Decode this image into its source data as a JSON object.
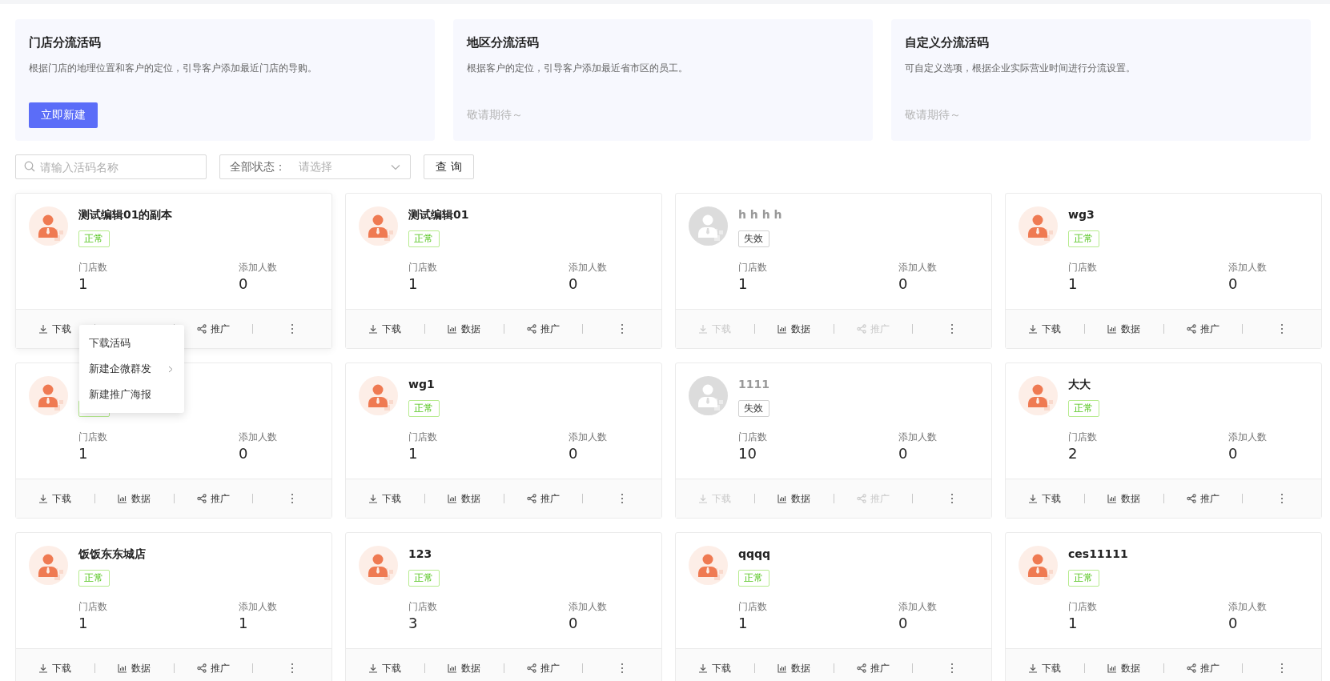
{
  "feature_cards": [
    {
      "title": "门店分流活码",
      "description": "根据门店的地理位置和客户的定位，引导客户添加最近门店的导购。",
      "button": "立即新建"
    },
    {
      "title": "地区分流活码",
      "description": "根据客户的定位，引导客户添加最近省市区的员工。",
      "note": "敬请期待～"
    },
    {
      "title": "自定义分流活码",
      "description": "可自定义选项，根据企业实际营业时间进行分流设置。",
      "note": "敬请期待～"
    }
  ],
  "filters": {
    "search": {
      "placeholder": "请输入活码名称"
    },
    "status_select": {
      "label": "全部状态：",
      "placeholder": "请选择"
    },
    "query_button": "查 询"
  },
  "codes": [
    {
      "name": "测试编辑01的副本",
      "expired": false,
      "status_label": "正常",
      "stats": [
        {
          "label": "门店数",
          "value": "1"
        },
        {
          "label": "添加人数",
          "value": "0"
        }
      ],
      "actions": [
        {
          "kind": "download",
          "label": "下载",
          "disabled": false
        },
        {
          "kind": "data"
        },
        {
          "kind": "promote",
          "label": "推广",
          "disabled": false
        },
        {
          "kind": "more"
        }
      ],
      "menu": [
        {
          "label": "下载活码",
          "submenu": false
        },
        {
          "label": "新建企微群发",
          "submenu": true
        },
        {
          "label": "新建推广海报",
          "submenu": false
        }
      ]
    },
    {
      "name": "测试编辑01",
      "expired": false,
      "status_label": "正常",
      "stats": [
        {
          "label": "门店数",
          "value": "1"
        },
        {
          "label": "添加人数",
          "value": "0"
        }
      ],
      "actions": [
        {
          "kind": "download",
          "label": "下载",
          "disabled": false
        },
        {
          "kind": "data",
          "label": "数据",
          "disabled": false
        },
        {
          "kind": "promote",
          "label": "推广",
          "disabled": false
        },
        {
          "kind": "more"
        }
      ]
    },
    {
      "name": "h h h h",
      "expired": true,
      "status_label": "失效",
      "stats": [
        {
          "label": "门店数",
          "value": "1"
        },
        {
          "label": "添加人数",
          "value": "0"
        }
      ],
      "actions": [
        {
          "kind": "download",
          "label": "下载",
          "disabled": true
        },
        {
          "kind": "data",
          "label": "数据",
          "disabled": false
        },
        {
          "kind": "promote",
          "label": "推广",
          "disabled": true
        },
        {
          "kind": "more"
        }
      ]
    },
    {
      "name": "wg3",
      "expired": false,
      "status_label": "正常",
      "stats": [
        {
          "label": "门店数",
          "value": "1"
        },
        {
          "label": "添加人数",
          "value": "0"
        }
      ],
      "actions": [
        {
          "kind": "download",
          "label": "下载",
          "disabled": false
        },
        {
          "kind": "data",
          "label": "数据",
          "disabled": false
        },
        {
          "kind": "promote",
          "label": "推广",
          "disabled": false
        },
        {
          "kind": "more"
        }
      ]
    },
    {
      "expired": false,
      "stats": [
        {
          "label": "门店数",
          "value": "1"
        },
        {
          "label": "添加人数",
          "value": "0"
        }
      ],
      "actions": [
        {
          "kind": "download",
          "label": "下载",
          "disabled": false
        },
        {
          "kind": "data",
          "label": "数据",
          "disabled": false
        },
        {
          "kind": "promote",
          "label": "推广",
          "disabled": false
        },
        {
          "kind": "more"
        }
      ]
    },
    {
      "name": "wg1",
      "expired": false,
      "status_label": "正常",
      "stats": [
        {
          "label": "门店数",
          "value": "1"
        },
        {
          "label": "添加人数",
          "value": "0"
        }
      ],
      "actions": [
        {
          "kind": "download",
          "label": "下载",
          "disabled": false
        },
        {
          "kind": "data",
          "label": "数据",
          "disabled": false
        },
        {
          "kind": "promote",
          "label": "推广",
          "disabled": false
        },
        {
          "kind": "more"
        }
      ]
    },
    {
      "name": "1111",
      "expired": true,
      "status_label": "失效",
      "stats": [
        {
          "label": "门店数",
          "value": "10"
        },
        {
          "label": "添加人数",
          "value": "0"
        }
      ],
      "actions": [
        {
          "kind": "download",
          "label": "下载",
          "disabled": true
        },
        {
          "kind": "data",
          "label": "数据",
          "disabled": false
        },
        {
          "kind": "promote",
          "label": "推广",
          "disabled": true
        },
        {
          "kind": "more"
        }
      ]
    },
    {
      "name": "大大",
      "expired": false,
      "status_label": "正常",
      "stats": [
        {
          "label": "门店数",
          "value": "2"
        },
        {
          "label": "添加人数",
          "value": "0"
        }
      ],
      "actions": [
        {
          "kind": "download",
          "label": "下载",
          "disabled": false
        },
        {
          "kind": "data",
          "label": "数据",
          "disabled": false
        },
        {
          "kind": "promote",
          "label": "推广",
          "disabled": false
        },
        {
          "kind": "more"
        }
      ]
    },
    {
      "name": "饭饭东东城店",
      "expired": false,
      "status_label": "正常",
      "stats": [
        {
          "label": "门店数",
          "value": "1"
        },
        {
          "label": "添加人数",
          "value": "1"
        }
      ],
      "actions": [
        {
          "kind": "download",
          "label": "下载",
          "disabled": false
        },
        {
          "kind": "data",
          "label": "数据",
          "disabled": false
        },
        {
          "kind": "promote",
          "label": "推广",
          "disabled": false
        },
        {
          "kind": "more"
        }
      ]
    },
    {
      "name": "123",
      "expired": false,
      "status_label": "正常",
      "stats": [
        {
          "label": "门店数",
          "value": "3"
        },
        {
          "label": "添加人数",
          "value": "0"
        }
      ],
      "actions": [
        {
          "kind": "download",
          "label": "下载",
          "disabled": false
        },
        {
          "kind": "data",
          "label": "数据",
          "disabled": false
        },
        {
          "kind": "promote",
          "label": "推广",
          "disabled": false
        },
        {
          "kind": "more"
        }
      ]
    },
    {
      "name": "qqqq",
      "expired": false,
      "status_label": "正常",
      "stats": [
        {
          "label": "门店数",
          "value": "1"
        },
        {
          "label": "添加人数",
          "value": "0"
        }
      ],
      "actions": [
        {
          "kind": "download",
          "label": "下载",
          "disabled": false
        },
        {
          "kind": "data",
          "label": "数据",
          "disabled": false
        },
        {
          "kind": "promote",
          "label": "推广",
          "disabled": false
        },
        {
          "kind": "more"
        }
      ]
    },
    {
      "name": "ces11111",
      "expired": false,
      "status_label": "正常",
      "stats": [
        {
          "label": "门店数",
          "value": "1"
        },
        {
          "label": "添加人数",
          "value": "0"
        }
      ],
      "actions": [
        {
          "kind": "download",
          "label": "下载",
          "disabled": false
        },
        {
          "kind": "data",
          "label": "数据",
          "disabled": false
        },
        {
          "kind": "promote",
          "label": "推广",
          "disabled": false
        },
        {
          "kind": "more"
        }
      ]
    }
  ]
}
